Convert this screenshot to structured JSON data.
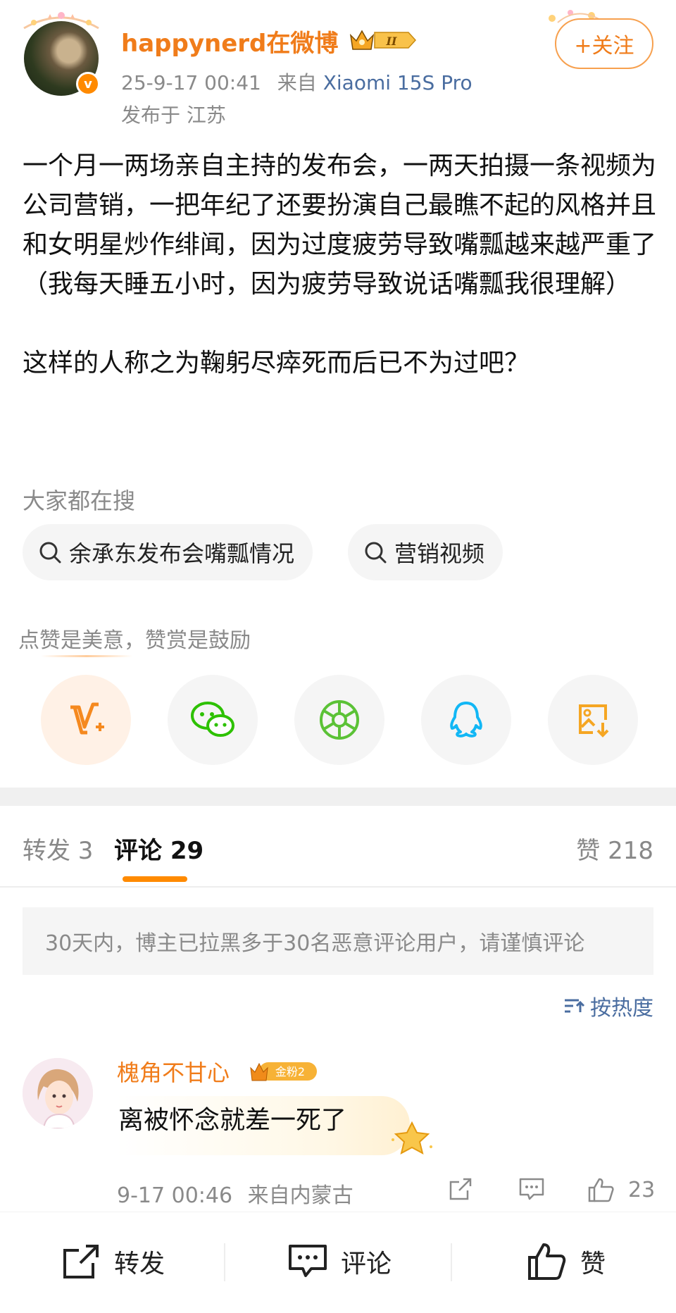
{
  "header": {
    "username": "happynerd在微博",
    "crown_level": "II",
    "verify_mark": "v",
    "timestamp": "25-9-17 00:41",
    "source_prefix": "来自",
    "device": "Xiaomi 15S Pro",
    "location": "发布于 江苏",
    "follow_label": "+关注"
  },
  "post": {
    "text": "一个月一两场亲自主持的发布会，一两天拍摄一条视频为公司营销，一把年纪了还要扮演自己最瞧不起的风格并且和女明星炒作绯闻，因为过度疲劳导致嘴瓢越来越严重了\n（我每天睡五小时，因为疲劳导致说话嘴瓢我很理解）\n\n这样的人称之为鞠躬尽瘁死而后已不为过吧？"
  },
  "search": {
    "label": "大家都在搜",
    "chips": [
      "余承东发布会嘴瓢情况",
      "营销视频"
    ]
  },
  "praise": {
    "label": "点赞是美意，赞赏是鼓励",
    "buttons": [
      "weibo-v-plus",
      "wechat",
      "moments",
      "qq",
      "save-image"
    ]
  },
  "tabs": {
    "repost": "转发 3",
    "comments": "评论 29",
    "likes": "赞 218"
  },
  "notice": "30天内，博主已拉黑多于30名恶意评论用户，请谨慎评论",
  "sort_label": "按热度",
  "comment": {
    "name": "槐角不甘心",
    "fan_badge": "金粉2",
    "text": "离被怀念就差一死了",
    "time": "9-17 00:46",
    "location": "来自内蒙古",
    "like_count": "23"
  },
  "bottom_bar": {
    "repost": "转发",
    "comment": "评论",
    "like": "赞"
  },
  "colors": {
    "accent_orange": "#f07c1a",
    "link_blue": "#4a6da0",
    "tab_indicator": "#ff8a00",
    "wechat_green": "#2dc100",
    "qq_blue": "#12b7f5"
  }
}
